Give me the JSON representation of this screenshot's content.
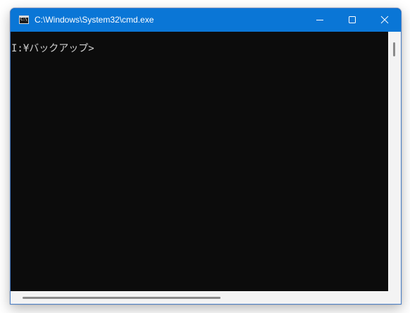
{
  "window": {
    "title": "C:\\Windows\\System32\\cmd.exe",
    "icon": "cmd-app-icon",
    "icon_glyph": "C:\\",
    "titlebar_color": "#0a76d6",
    "controls": {
      "minimize_icon": "minimize-icon",
      "maximize_icon": "maximize-icon",
      "close_icon": "close-icon"
    }
  },
  "console": {
    "background": "#0c0c0c",
    "text_color": "#d0d0d0",
    "prompt": "I:¥バックアップ>"
  }
}
